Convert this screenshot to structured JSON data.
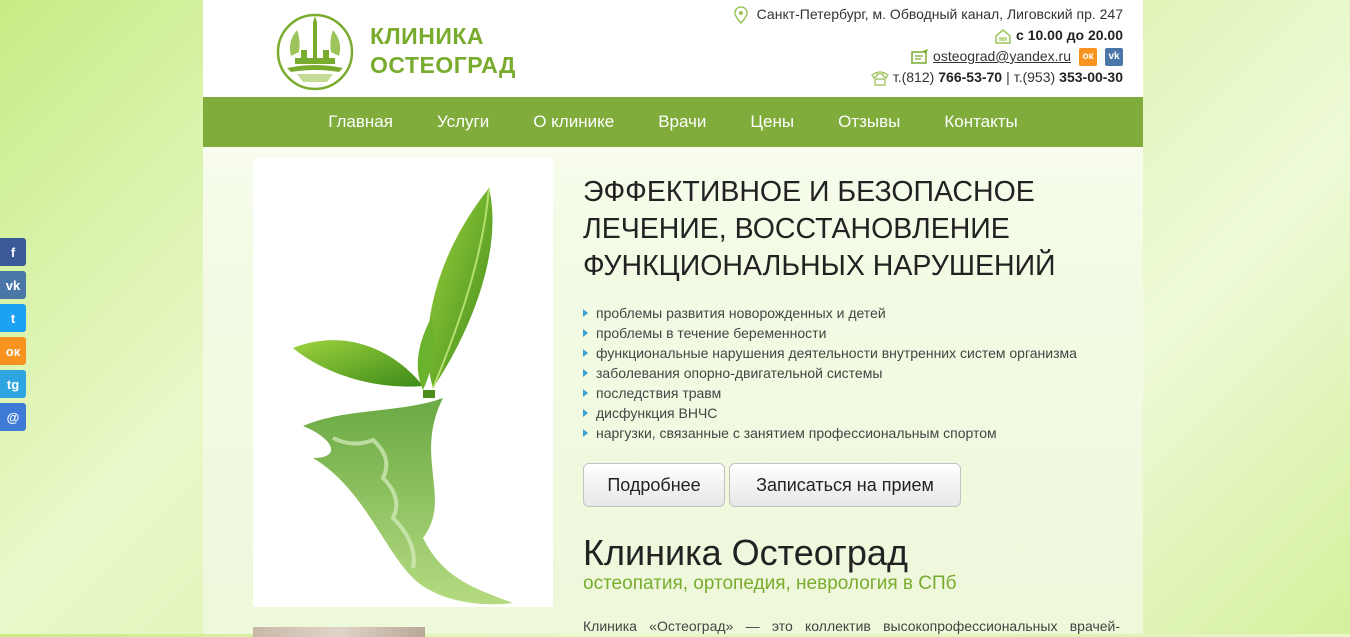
{
  "logo": {
    "line1": "КЛИНИКА",
    "line2": "ОСТЕОГРАД"
  },
  "contacts": {
    "address": "Санкт-Петербург, м. Обводный канал, Лиговский пр. 247",
    "hours": "с 10.00 до 20.00",
    "email": "osteograd@yandex.ru",
    "phone1_prefix": "т.(812)",
    "phone1": "766-53-70",
    "separator": "|",
    "phone2_prefix": "т.(953)",
    "phone2": "353-00-30"
  },
  "nav": {
    "items": [
      {
        "label": "Главная"
      },
      {
        "label": "Услуги"
      },
      {
        "label": "О клинике"
      },
      {
        "label": "Врачи"
      },
      {
        "label": "Цены"
      },
      {
        "label": "Отзывы"
      },
      {
        "label": "Контакты"
      }
    ]
  },
  "hero": {
    "title": "ЭФФЕКТИВНОЕ И БЕЗОПАСНОЕ ЛЕЧЕНИЕ, ВОССТАНОВЛЕНИЕ ФУНКЦИОНАЛЬНЫХ НАРУШЕНИЙ",
    "features": [
      "проблемы развития новорожденных и детей",
      "проблемы в течение беременности",
      "функциональные нарушения деятельности внутренних систем организма",
      "заболевания опорно-двигательной системы",
      "последствия травм",
      "дисфункция ВНЧС",
      "наргузки, связанные с занятием профессиональным спортом"
    ],
    "btn_more": "Подробнее",
    "btn_book": "Записаться на прием"
  },
  "clinic": {
    "title": "Клиника Остеоград",
    "subtitle": "остеопатия, ортопедия, неврология в СПб",
    "description": "Клиника «Остеоград» — это коллектив высокопрофессиональных врачей-"
  },
  "social_inline": {
    "ok": "ок",
    "vk": "vk"
  },
  "share": {
    "facebook": "f",
    "vk": "vk",
    "twitter": "t",
    "ok": "ок",
    "telegram": "tg",
    "email": "@"
  },
  "colors": {
    "brand_green": "#7fac3a",
    "logo_green": "#79ac2e",
    "bullet_blue": "#3aa0d8",
    "ok_orange": "#f7931e",
    "vk_blue": "#4a76a8"
  }
}
